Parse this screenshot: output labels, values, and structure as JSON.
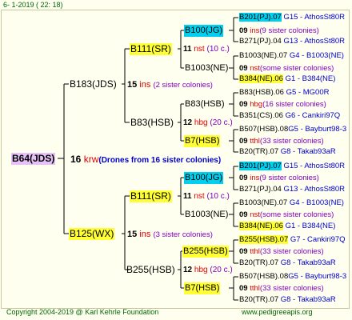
{
  "header": "6-  1-2019 ( 22: 18)",
  "footer": {
    "copyright": "Copyright 2004-2019 @ Karl Kehrle Foundation",
    "site": "www.pedigreeapis.org"
  },
  "root": {
    "label": "B64(JDS)",
    "num": "16",
    "code": "krw",
    "note": "(Drones from 16 sister colonies)"
  },
  "gen1": [
    {
      "label": "B183(JDS)",
      "num": "15",
      "code": "ins",
      "note": "(2 sister colonies)"
    },
    {
      "label": "B125(WX)",
      "num": "15",
      "code": "ins",
      "note": "(3 sister colonies)"
    }
  ],
  "gen2": [
    {
      "label": "B111(SR)",
      "num": "11",
      "code": "nst",
      "note": "(10 c.)"
    },
    {
      "label": "B83(HSB)",
      "num": "12",
      "code": "hbg",
      "note": "(20 c.)"
    },
    {
      "label": "B111(SR)",
      "num": "11",
      "code": "nst",
      "note": "(10 c.)"
    },
    {
      "label": "B255(HSB)",
      "num": "12",
      "code": "hbg",
      "note": "(20 c.)"
    }
  ],
  "gen3": [
    {
      "label": "B100(JG)",
      "num": "09",
      "code": "ins",
      "note": "(9 sister colonies)"
    },
    {
      "label": "B1003(NE)",
      "num": "09",
      "code": "nst",
      "note": "(some sister colonies)"
    },
    {
      "label": "B83(HSB)",
      "num": "09",
      "code": "hbg",
      "note": "(16 sister colonies)"
    },
    {
      "label": "B7(HSB)",
      "num": "09",
      "code": "tthl",
      "note": "(33 sister colonies)"
    },
    {
      "label": "B100(JG)",
      "num": "09",
      "code": "ins",
      "note": "(9 sister colonies)"
    },
    {
      "label": "B1003(NE)",
      "num": "09",
      "code": "nst",
      "note": "(some sister colonies)"
    },
    {
      "label": "B255(HSB)",
      "num": "09",
      "code": "tthl",
      "note": "(33 sister colonies)"
    },
    {
      "label": "B7(HSB)",
      "num": "09",
      "code": "tthl",
      "note": "(33 sister colonies)"
    }
  ],
  "gen4": [
    {
      "a": "B201(PJ).07",
      "b": "G15 - AthosSt80R"
    },
    {
      "a": "B271(PJ).04",
      "b": "G13 - AthosSt80R"
    },
    {
      "a": "B1003(NE).07",
      "b": "G4 - B1003(NE)"
    },
    {
      "a": "B384(NE).06",
      "b": "G1 - B384(NE)"
    },
    {
      "a": "B83(HSB).06",
      "b": "G5 - MG00R"
    },
    {
      "a": "B351(CS).06",
      "b": "G6 - Cankiri97Q"
    },
    {
      "a": "B507(HSB).08",
      "b": "G5 - Bayburt98-3"
    },
    {
      "a": "B20(TR).07",
      "b": "G8 - Takab93aR"
    },
    {
      "a": "B201(PJ).07",
      "b": "G15 - AthosSt80R"
    },
    {
      "a": "B271(PJ).04",
      "b": "G13 - AthosSt80R"
    },
    {
      "a": "B1003(NE).07",
      "b": "G4 - B1003(NE)"
    },
    {
      "a": "B384(NE).06",
      "b": "G1 - B384(NE)"
    },
    {
      "a": "B255(HSB).07",
      "b": "G7 - Cankiri97Q"
    },
    {
      "a": "B20(TR).07",
      "b": "G8 - Takab93aR"
    },
    {
      "a": "B507(HSB).08",
      "b": "G5 - Bayburt98-3"
    },
    {
      "a": "B20(TR).07",
      "b": "G8 - Takab93aR"
    }
  ]
}
